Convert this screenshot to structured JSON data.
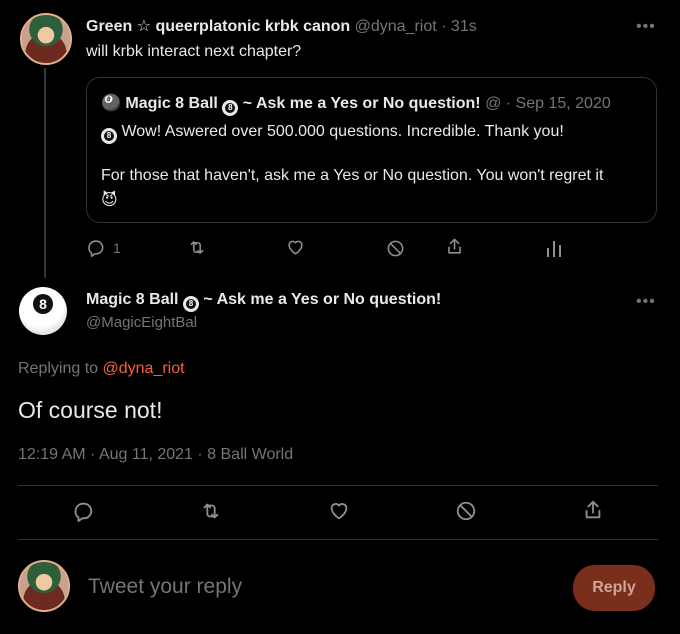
{
  "tweet": {
    "display_name": "Green ☆ queerplatonic krbk canon",
    "handle": "@dyna_riot",
    "time": "· 31s",
    "text": "will krbk interact next chapter?",
    "reply_count": "1"
  },
  "quoted": {
    "emoji": "🎱",
    "name": "Magic 8 Ball",
    "badge": "8",
    "suffix": "~ Ask me a Yes or No question!",
    "handle": "@",
    "date": "· Sep 15, 2020",
    "line1": "Wow! Aswered over 500.000 questions. Incredible. Thank you!",
    "line2": "For those that haven't, ask me a Yes or No question. You won't regret it",
    "emoji2": "😈"
  },
  "main": {
    "avatar_label": "8",
    "name": "Magic 8 Ball",
    "badge": "8",
    "suffix": "~ Ask me a Yes or No question!",
    "handle": "@MagicEightBal",
    "replying_prefix": "Replying to",
    "replying_handle": "@dyna_riot",
    "text": "Of course not!",
    "meta": "12:19 AM · Aug 11, 2021 · 8 Ball World"
  },
  "compose": {
    "placeholder": "Tweet your reply",
    "button": "Reply"
  },
  "colors": {
    "accent": "#f4623a",
    "reply_button": "#7a2e1c"
  }
}
